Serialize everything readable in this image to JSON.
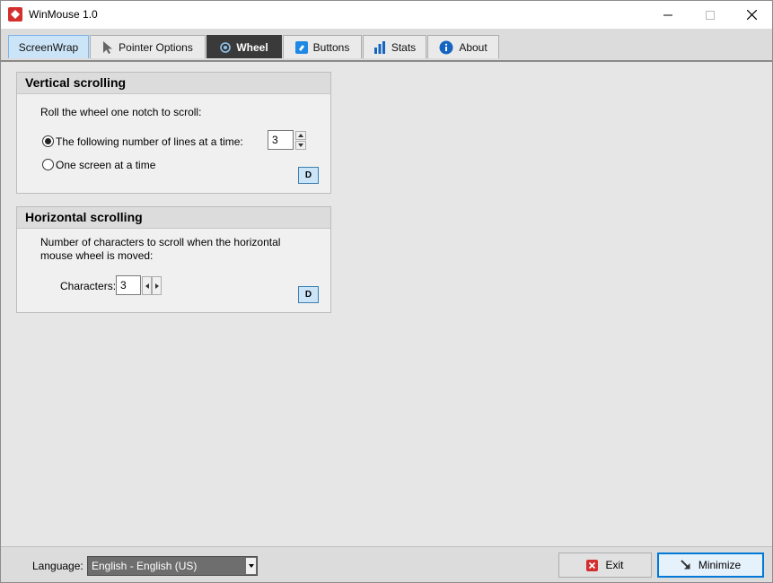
{
  "window": {
    "title": "WinMouse 1.0"
  },
  "tabs": [
    {
      "label": "ScreenWrap"
    },
    {
      "label": "Pointer Options"
    },
    {
      "label": "Wheel"
    },
    {
      "label": "Buttons"
    },
    {
      "label": "Stats"
    },
    {
      "label": "About"
    }
  ],
  "vertical": {
    "header": "Vertical scrolling",
    "instruction": "Roll the wheel one notch to scroll:",
    "option_lines_label": "The following number of lines at a time:",
    "lines_value": "3",
    "option_screen_label": "One screen at a time",
    "default_button": "D"
  },
  "horizontal": {
    "header": "Horizontal scrolling",
    "instruction_line1": "Number of characters to scroll when the horizontal",
    "instruction_line2": "mouse wheel is moved:",
    "characters_label": "Characters:",
    "characters_value": "3",
    "default_button": "D"
  },
  "footer": {
    "language_label": "Language:",
    "language_value": "English  -  English (US)",
    "exit_label": "Exit",
    "minimize_label": "Minimize"
  },
  "colors": {
    "accent": "#0078d7",
    "active_tab": "#3a3a3a",
    "highlight_tab": "#cce4f7",
    "exit_icon": "#d32f2f"
  }
}
